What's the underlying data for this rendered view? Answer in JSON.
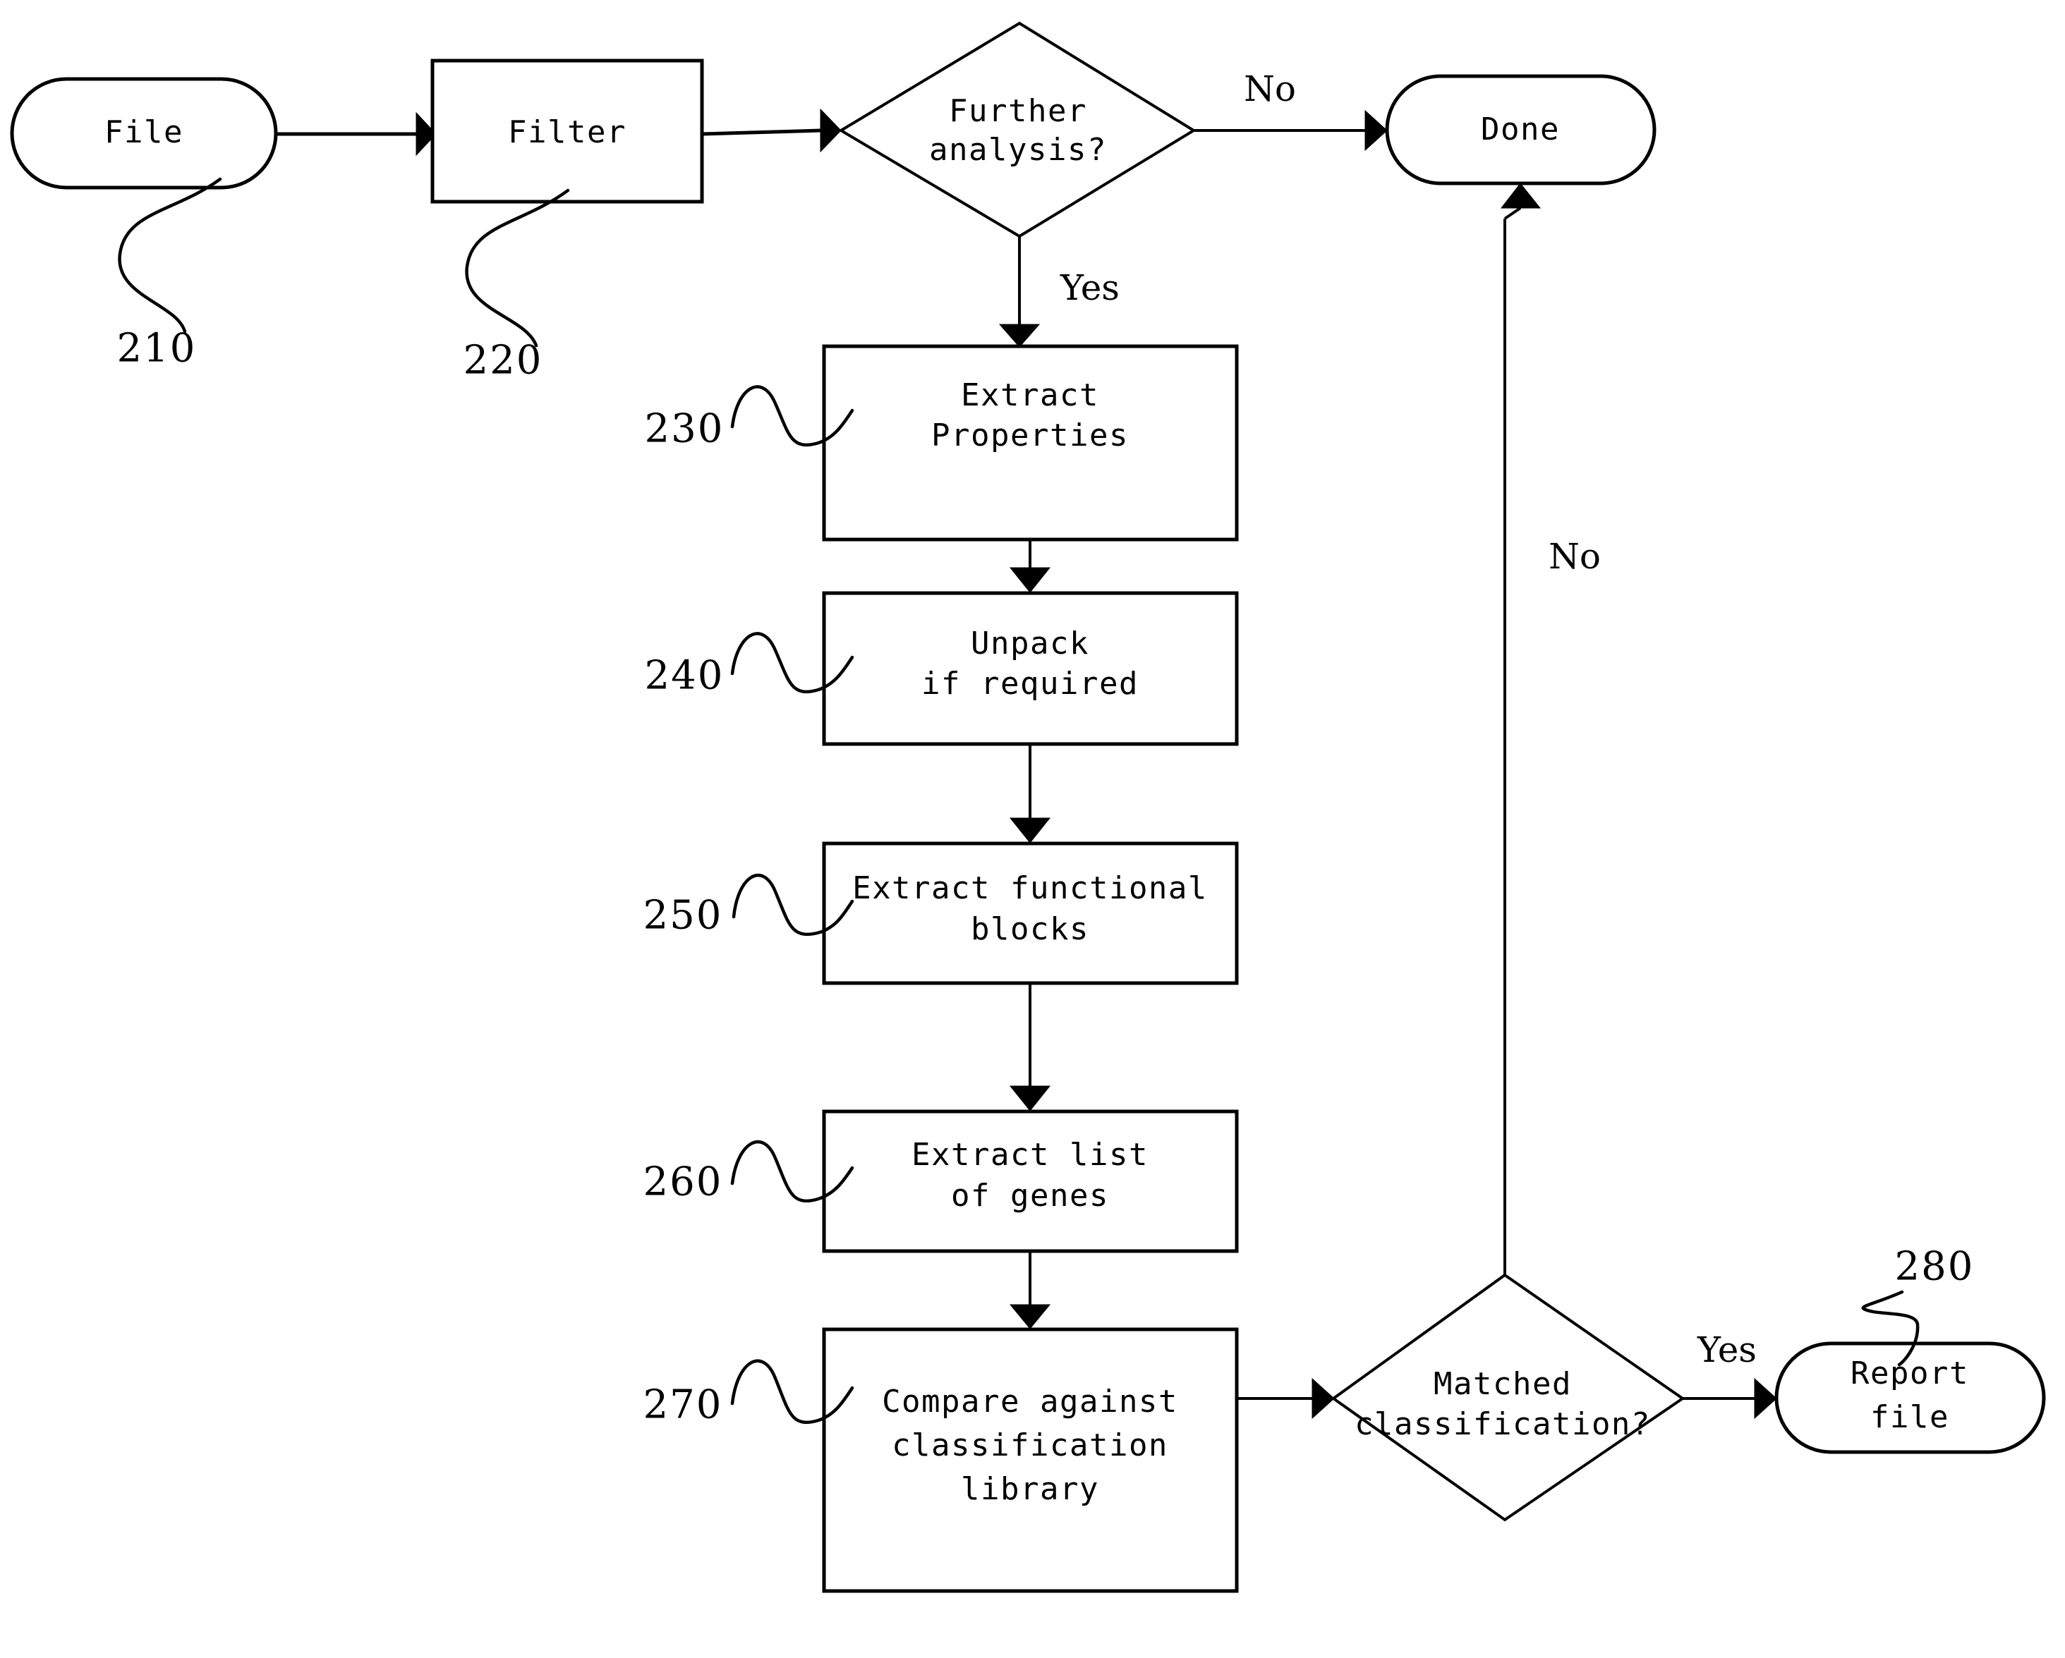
{
  "diagram": {
    "type": "flowchart",
    "background_color": "#ffffff",
    "line_color": "#000000",
    "nodes": [
      {
        "id": "file",
        "label": "File",
        "shape": "stadium",
        "ref": "210"
      },
      {
        "id": "filter",
        "label": "Filter",
        "shape": "rectangle",
        "ref": "220"
      },
      {
        "id": "further",
        "label_line1": "Further",
        "label_line2": "analysis?",
        "shape": "diamond",
        "ref": ""
      },
      {
        "id": "done",
        "label": "Done",
        "shape": "stadium",
        "ref": ""
      },
      {
        "id": "extract_properties",
        "label_line1": "Extract",
        "label_line2": "Properties",
        "shape": "rectangle",
        "ref": "230"
      },
      {
        "id": "unpack",
        "label_line1": "Unpack",
        "label_line2": "if required",
        "shape": "rectangle",
        "ref": "240"
      },
      {
        "id": "functional_blocks",
        "label_line1": "Extract functional",
        "label_line2": "blocks",
        "shape": "rectangle",
        "ref": "250"
      },
      {
        "id": "list_genes",
        "label_line1": "Extract list",
        "label_line2": "of genes",
        "shape": "rectangle",
        "ref": "260"
      },
      {
        "id": "compare",
        "label_line1": "Compare against",
        "label_line2": "classification",
        "label_line3": "library",
        "shape": "rectangle",
        "ref": "270"
      },
      {
        "id": "matched",
        "label_line1": "Matched",
        "label_line2": "classification?",
        "shape": "diamond",
        "ref": ""
      },
      {
        "id": "report",
        "label_line1": "Report",
        "label_line2": "file",
        "shape": "stadium",
        "ref": "280"
      }
    ],
    "edge_labels": {
      "further_no": "No",
      "further_yes": "Yes",
      "matched_no": "No",
      "matched_yes": "Yes"
    },
    "reference_numerals": {
      "file": "210",
      "filter": "220",
      "extract_properties": "230",
      "unpack": "240",
      "functional_blocks": "250",
      "list_genes": "260",
      "compare": "270",
      "report": "280"
    }
  }
}
